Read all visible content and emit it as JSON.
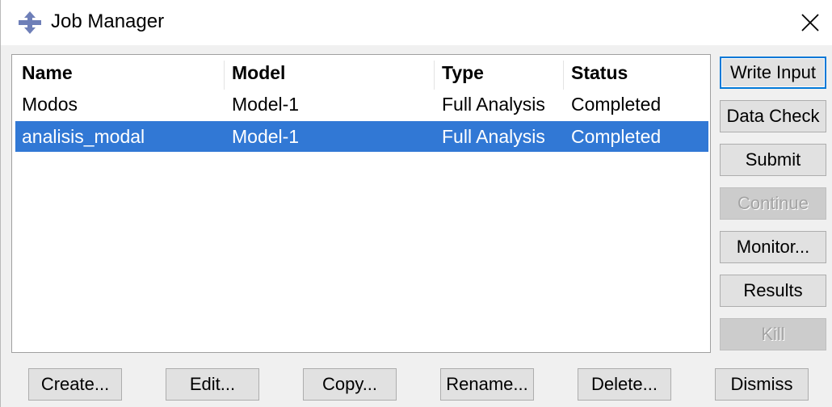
{
  "window": {
    "title": "Job Manager",
    "icon": "abaqus-app-icon",
    "close_icon": "close-icon"
  },
  "table": {
    "columns": [
      "Name",
      "Model",
      "Type",
      "Status"
    ],
    "rows": [
      {
        "name": "Modos",
        "model": "Model-1",
        "type": "Full Analysis",
        "status": "Completed",
        "selected": false
      },
      {
        "name": "analisis_modal",
        "model": "Model-1",
        "type": "Full Analysis",
        "status": "Completed",
        "selected": true
      }
    ]
  },
  "side_buttons": {
    "write_input": "Write Input",
    "data_check": "Data Check",
    "submit": "Submit",
    "continue": "Continue",
    "monitor": "Monitor...",
    "results": "Results",
    "kill": "Kill"
  },
  "bottom_buttons": {
    "create": "Create...",
    "edit": "Edit...",
    "copy": "Copy...",
    "rename": "Rename...",
    "delete": "Delete...",
    "dismiss": "Dismiss"
  },
  "colors": {
    "selection": "#3178d5",
    "default_button_border": "#0078d7"
  }
}
